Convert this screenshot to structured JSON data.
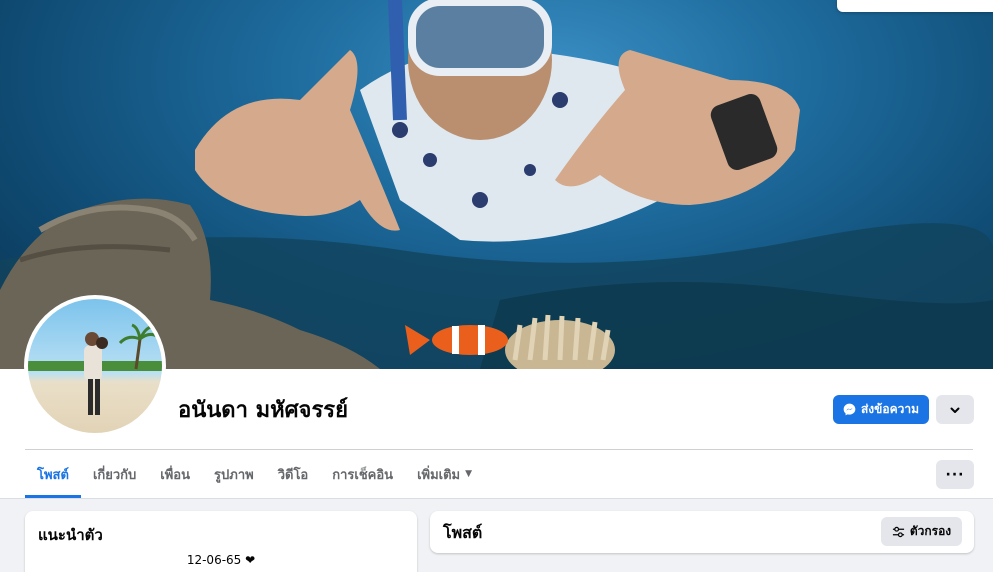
{
  "profile": {
    "name": "อนันดา มหัศจรรย์"
  },
  "actions": {
    "message_label": "ส่งข้อความ"
  },
  "tabs": [
    {
      "label": "โพสต์",
      "active": true
    },
    {
      "label": "เกี่ยวกับ",
      "active": false
    },
    {
      "label": "เพื่อน",
      "active": false
    },
    {
      "label": "รูปภาพ",
      "active": false
    },
    {
      "label": "วิดีโอ",
      "active": false
    },
    {
      "label": "การเช็คอิน",
      "active": false
    },
    {
      "label": "เพิ่มเติม",
      "active": false,
      "has_caret": true
    }
  ],
  "intro": {
    "title": "แนะนำตัว",
    "bio": "12-06-65 ❤"
  },
  "posts": {
    "title": "โพสต์",
    "filter_label": "ตัวกรอง"
  },
  "icons": {
    "messenger": "messenger-icon",
    "chevron": "chevron-down-icon",
    "more": "more-dots-icon",
    "filter": "filter-icon"
  },
  "colors": {
    "accent": "#1b74e4",
    "button_gray": "#e4e6eb",
    "background": "#f0f2f5"
  }
}
